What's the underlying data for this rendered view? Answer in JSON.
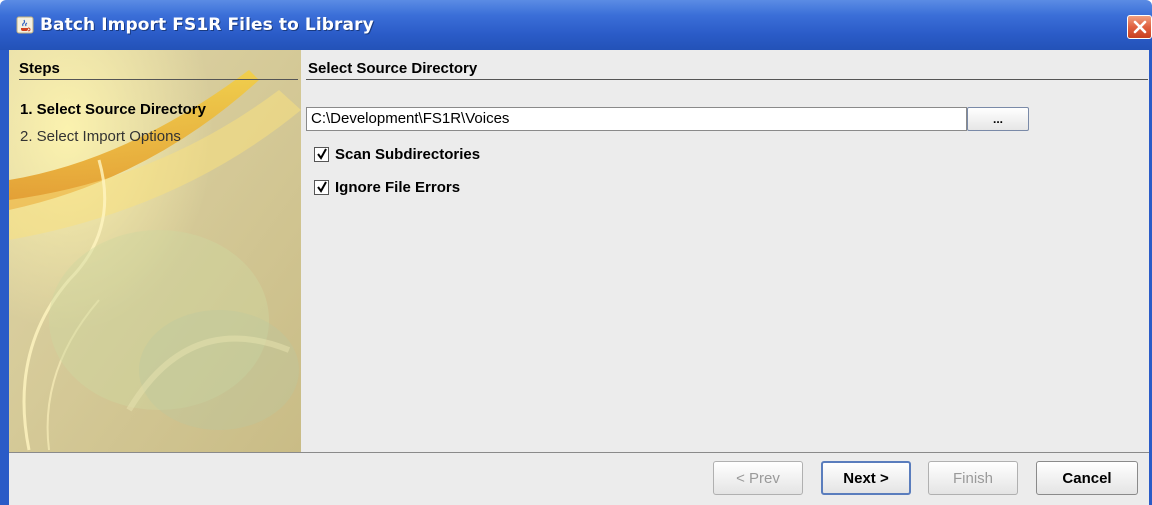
{
  "window": {
    "title": "Batch Import FS1R Files to Library",
    "icons": [
      "java-cup-icon",
      "close-icon"
    ]
  },
  "steps": {
    "heading": "Steps",
    "items": [
      {
        "label": "1. Select Source Directory",
        "active": true
      },
      {
        "label": "2. Select Import Options",
        "active": false
      }
    ]
  },
  "content": {
    "heading": "Select Source Directory",
    "path_value": "C:\\Development\\FS1R\\Voices",
    "browse_label": "...",
    "options": [
      {
        "label": "Scan Subdirectories",
        "checked": true
      },
      {
        "label": "Ignore File Errors",
        "checked": true
      }
    ]
  },
  "buttons": {
    "prev": "< Prev",
    "next": "Next >",
    "finish": "Finish",
    "cancel": "Cancel"
  },
  "colors": {
    "titlebar": "#2a5bc7",
    "steps_panel": "#d8cb9a",
    "content_bg": "#ececec",
    "close": "#e06040"
  }
}
